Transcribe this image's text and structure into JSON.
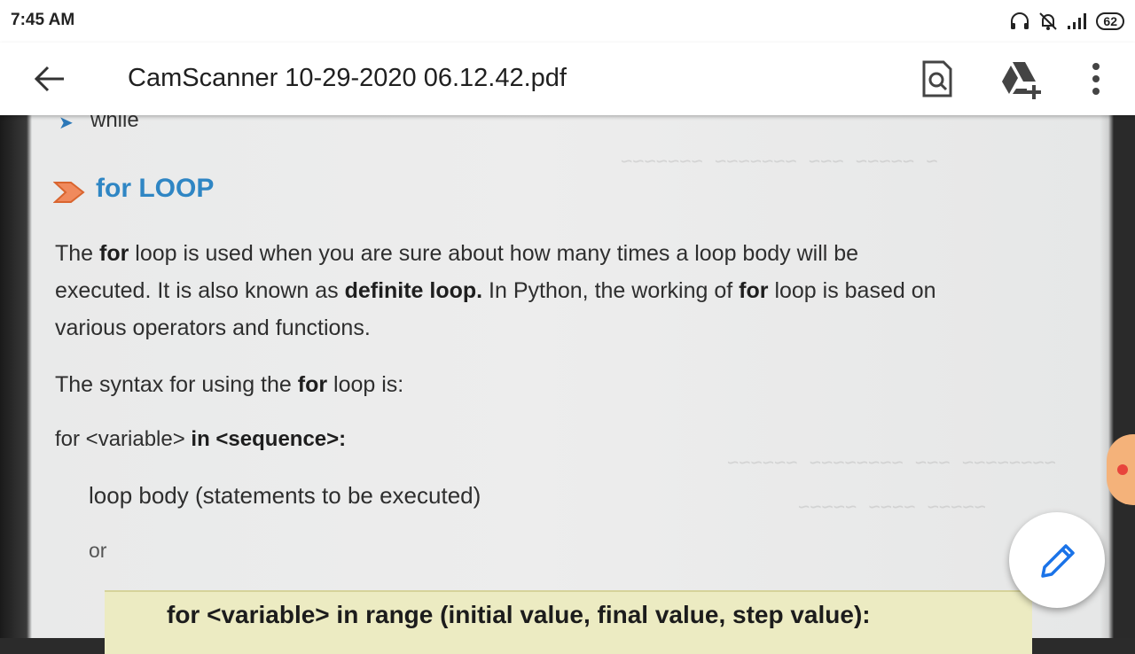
{
  "status_bar": {
    "time": "7:45 AM",
    "battery": "62",
    "icons": [
      "headset-icon",
      "notifications-muted-icon",
      "signal-icon",
      "battery-icon"
    ]
  },
  "app_bar": {
    "title": "CamScanner 10-29-2020 06.12.42.pdf",
    "actions": [
      "back-arrow-icon",
      "search-document-icon",
      "add-to-drive-icon",
      "more-vert-icon"
    ]
  },
  "document": {
    "prev_item": "while",
    "heading": "for LOOP",
    "para1": {
      "line1_a": "The ",
      "line1_b": "for",
      "line1_c": " loop is used when you are sure about how many times a loop body will be",
      "line2_a": "executed. It is also known as ",
      "line2_b": "definite loop.",
      "line2_c": " In Python, the working of ",
      "line2_d": "for",
      "line2_e": " loop is based on",
      "line3": "various operators and functions."
    },
    "syntax_intro": {
      "a": "The syntax for using the ",
      "b": "for",
      "c": " loop is:"
    },
    "syntax1": {
      "a": "for <variable> ",
      "b": "in <sequence>:"
    },
    "loop_body": "loop body (statements to be executed)",
    "or": "or",
    "syntax2": "for <variable> in range (initial value, final value, step value):"
  },
  "fab": {
    "icon": "edit-pencil-icon"
  },
  "colors": {
    "heading": "#2f86c4",
    "syntax_box": "#ecebc2",
    "fab_icon": "#1a73e8"
  }
}
